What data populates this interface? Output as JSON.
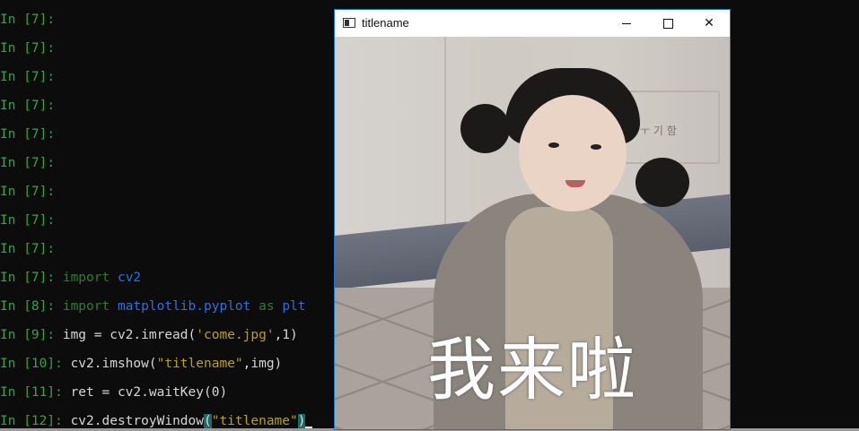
{
  "terminal": {
    "lines": [
      {
        "prompt": "In [7]:",
        "code": ""
      },
      {
        "prompt": "In [7]:",
        "code": ""
      },
      {
        "prompt": "In [7]:",
        "code": ""
      },
      {
        "prompt": "In [7]:",
        "code": ""
      },
      {
        "prompt": "In [7]:",
        "code": ""
      },
      {
        "prompt": "In [7]:",
        "code": ""
      },
      {
        "prompt": "In [7]:",
        "code": ""
      },
      {
        "prompt": "In [7]:",
        "code": ""
      },
      {
        "prompt": "In [7]:",
        "code": ""
      },
      {
        "prompt": "In [7]:",
        "code_parts": {
          "kw": "import",
          "mod": "cv2"
        }
      },
      {
        "prompt": "In [8]:",
        "code_parts": {
          "kw": "import",
          "mod": "matplotlib.pyplot",
          "as": "as",
          "alias": "plt"
        }
      },
      {
        "prompt": "In [9]:",
        "code_parts": {
          "pre": "img = cv2.imread(",
          "str": "'come.jpg'",
          "post": ",1)"
        }
      },
      {
        "prompt": "In [10]:",
        "code_parts": {
          "pre": "cv2.imshow(",
          "str": "\"titlename\"",
          "post": ",img)"
        }
      },
      {
        "prompt": "In [11]:",
        "code_parts": {
          "pre": "ret = cv2.waitKey(0)"
        }
      },
      {
        "prompt": "In [12]:",
        "code_parts": {
          "pre": "cv2.destroyWindow",
          "open": "(",
          "str": "\"titlename\"",
          "close": ")"
        }
      }
    ]
  },
  "window": {
    "title": "titlename",
    "close_glyph": "✕",
    "caption": "我来啦",
    "sign_text": "ㅜ 기 함"
  },
  "colors": {
    "prompt": "#34a34a",
    "keyword": "#2e7d2e",
    "module": "#2f6fe0",
    "string": "#b8a020",
    "window_border": "#1878d6"
  }
}
